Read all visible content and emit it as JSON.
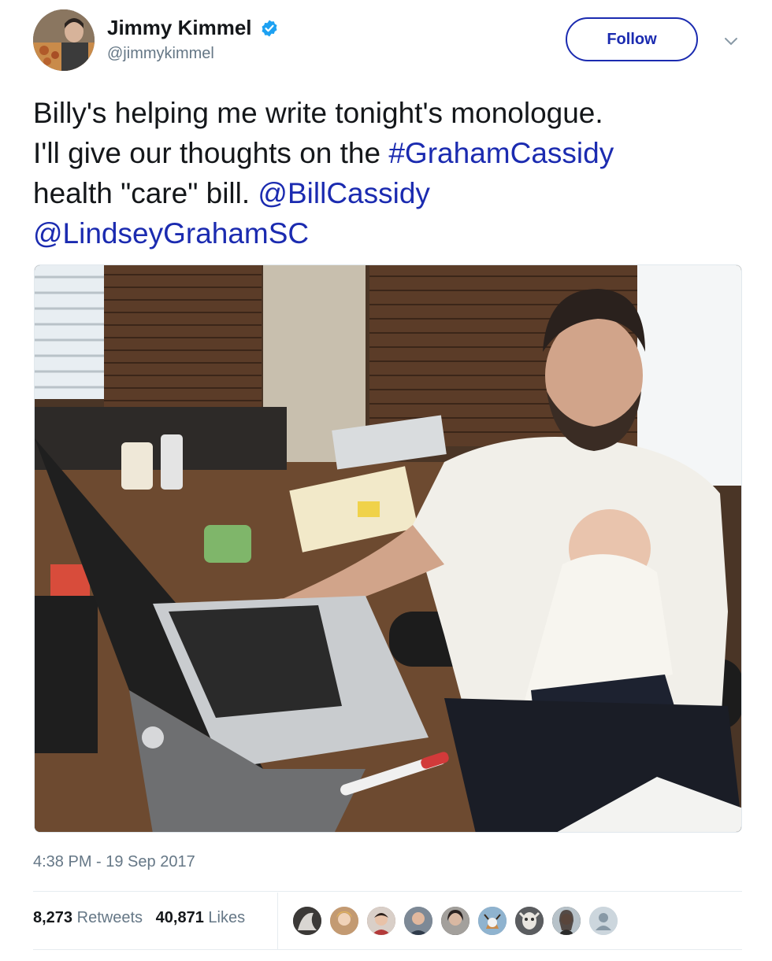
{
  "user": {
    "display_name": "Jimmy Kimmel",
    "handle": "@jimmykimmel",
    "verified_icon": "verified-badge-icon",
    "follow_label": "Follow"
  },
  "tweet": {
    "line1": "Billy's helping me write tonight's monologue.",
    "line2_prefix": "I'll give our thoughts on the ",
    "hashtag": "#GrahamCassidy",
    "line3_prefix": "health \"care\" bill. ",
    "mention1": "@BillCassidy",
    "mention2": "@LindseyGrahamSC"
  },
  "timestamp": "4:38 PM - 19 Sep 2017",
  "stats": {
    "retweets_count": "8,273",
    "retweets_label": "Retweets",
    "likes_count": "40,871",
    "likes_label": "Likes"
  },
  "colors": {
    "link": "#1b2bb0",
    "text": "#14171a",
    "muted": "#657786",
    "verified": "#1da1f2"
  }
}
